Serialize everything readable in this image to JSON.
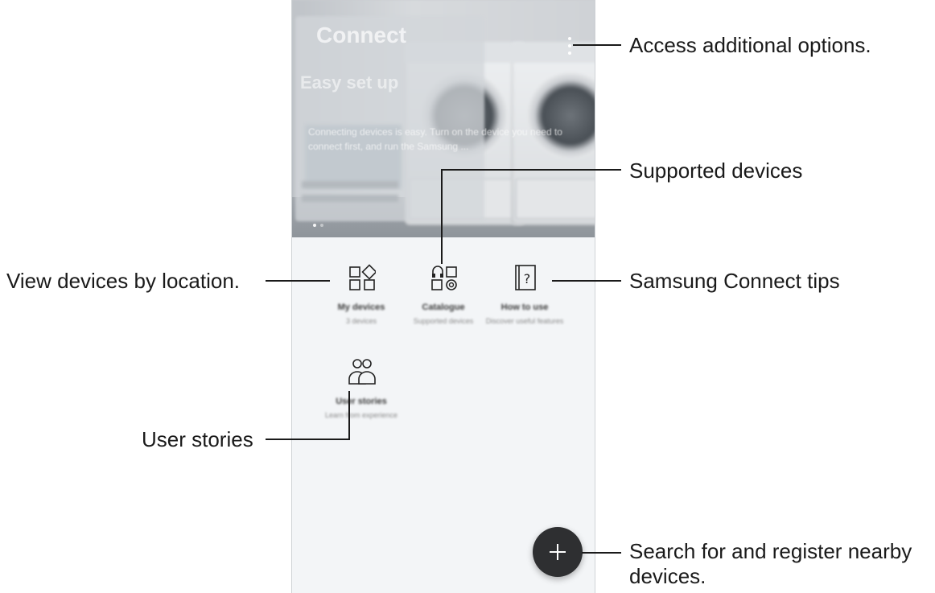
{
  "callouts": {
    "more_options": "Access additional options.",
    "supported_devices": "Supported devices",
    "view_by_location": "View devices by location.",
    "tips": "Samsung Connect tips",
    "user_stories": "User stories",
    "search_register": "Search for and register nearby",
    "search_register_line2": "devices."
  },
  "hero": {
    "app_title": "Connect",
    "card_title": "Easy set up",
    "card_text": "Connecting devices is easy. Turn on the device you need to connect first, and run the Samsung ..."
  },
  "tiles": [
    {
      "label": "My devices",
      "sub": "3 devices",
      "icon": "devices-grid-icon"
    },
    {
      "label": "Catalogue",
      "sub": "Supported devices",
      "icon": "catalogue-icon"
    },
    {
      "label": "How to use",
      "sub": "Discover useful features",
      "icon": "help-book-icon"
    },
    {
      "label": "User stories",
      "sub": "Learn from experience",
      "icon": "users-icon"
    }
  ],
  "colors": {
    "fab": "#2e2f31",
    "screen_bg": "#f3f5f7",
    "callout_text": "#1a1a1a"
  }
}
